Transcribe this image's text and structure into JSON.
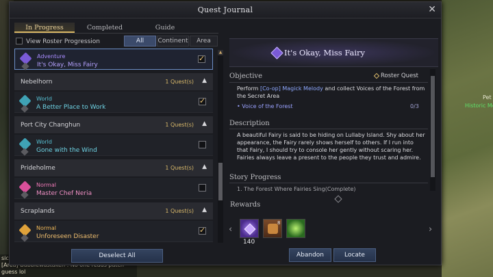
{
  "window": {
    "title": "Quest Journal",
    "close_glyph": "✕"
  },
  "tabs": [
    "In Progress",
    "Completed",
    "Guide"
  ],
  "active_tab": "In Progress",
  "roster_toggle": {
    "label": "View Roster Progression",
    "checked": false
  },
  "filters": [
    "All",
    "Continent",
    "Area"
  ],
  "active_filter": "All",
  "quest_list": {
    "selected": {
      "category": "Adventure",
      "name": "It's Okay, Miss Fairy",
      "checked": true
    },
    "groups": [
      {
        "name": "Nebelhorn",
        "count": "1 Quest(s)",
        "quest": {
          "category": "World",
          "name": "A Better Place to Work",
          "checked": true
        }
      },
      {
        "name": "Port City Changhun",
        "count": "1 Quest(s)",
        "quest": {
          "category": "World",
          "name": "Gone with the Wind",
          "checked": false
        }
      },
      {
        "name": "Prideholme",
        "count": "1 Quest(s)",
        "quest": {
          "category": "Normal",
          "name": "Master Chef Neria",
          "checked": false
        }
      },
      {
        "name": "Scraplands",
        "count": "1 Quest(s)",
        "quest": {
          "category": "Normal",
          "name": "Unforeseen Disaster",
          "checked": true
        }
      }
    ]
  },
  "buttons": {
    "deselect_all": "Deselect All",
    "abandon": "Abandon",
    "locate": "Locate"
  },
  "detail": {
    "quest_name": "It's Okay, Miss Fairy",
    "objective_header": "Objective",
    "quest_type": "Roster Quest",
    "objective_prefix": "Perform ",
    "objective_highlight": "[Co-op] Magick Melody",
    "objective_suffix": " and collect Voices of the Forest from the Secret Area",
    "task": {
      "label": "• Voice of the Forest",
      "progress": "0/3"
    },
    "description_header": "Description",
    "description": "A beautiful Fairy is said to be hiding on Lullaby Island. Shy about her appearance, the Fairy rarely shows herself to others. If I run into that Fairy, I should try to console her gently without scaring her. Fairies always leave a present to the people they trust and admire.",
    "story_header": "Story Progress",
    "story_item": "1. The Forest Where Fairies Sing(Complete)"
  },
  "rewards": {
    "header": "Rewards",
    "items": [
      {
        "icon": "purple-gem-icon",
        "count": "140"
      },
      {
        "icon": "treasure-chest-icon",
        "count": "8"
      },
      {
        "icon": "green-sparkle-icon",
        "count": ""
      }
    ]
  },
  "background": {
    "chat_lines": [
      "sic",
      "[Area] Bubblewastaken : No one reads patch",
      "guess lol"
    ],
    "npc_name": "Pet",
    "npc_subtitle": "Historic Mo"
  },
  "colors": {
    "accent_gold": "#d9b765",
    "highlight_blue": "#8ea8ff",
    "adventure_purple": "#7a5ad6",
    "world_teal": "#3fa2b5",
    "normal_pink": "#d9509a"
  }
}
